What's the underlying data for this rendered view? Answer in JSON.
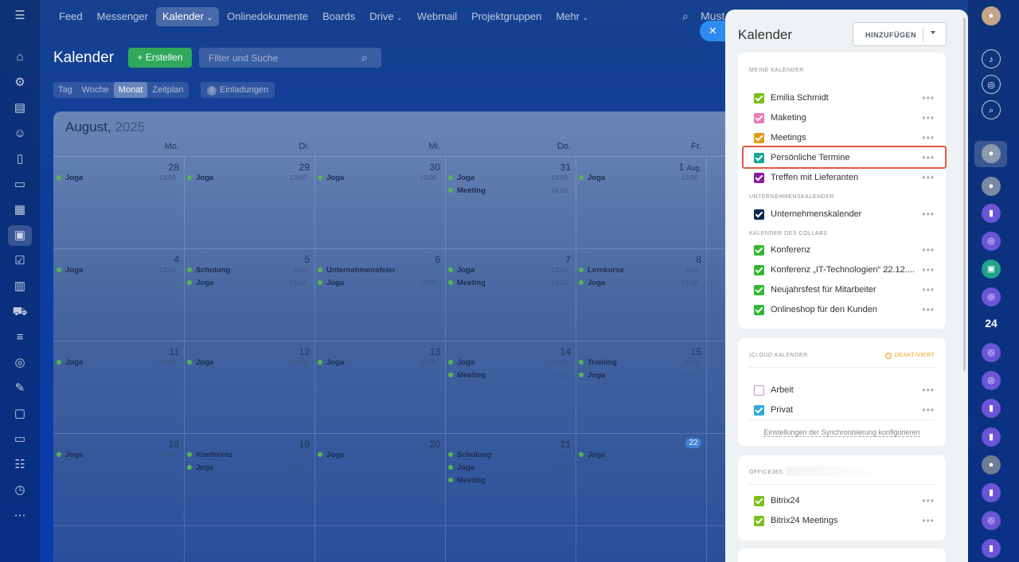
{
  "topnav": {
    "items": [
      "Feed",
      "Messenger",
      "Kalender",
      "Onlinedokumente",
      "Boards",
      "Drive",
      "Webmail",
      "Projektgruppen",
      "Mehr"
    ],
    "active": "Kalender",
    "user_partial": "Must"
  },
  "header": {
    "title": "Kalender",
    "create_label": "+ Erstellen",
    "search_placeholder": "Filter und Suche"
  },
  "view_tabs": [
    "Tag",
    "Woche",
    "Monat",
    "Zeitplan"
  ],
  "active_view": "Monat",
  "invitations": {
    "count": "0",
    "label": "Einladungen"
  },
  "calendar": {
    "month": "August,",
    "year": "2025",
    "weekdays": [
      "Mo.",
      "Di.",
      "Mi.",
      "Do.",
      "Fr."
    ],
    "weeks": [
      {
        "days": [
          "28",
          "29",
          "30",
          "31",
          "1"
        ],
        "day_suffix_fr": "Aug.",
        "events": [
          [
            {
              "title": "Joga",
              "time": "13:00"
            }
          ],
          [
            {
              "title": "Joga",
              "time": "13:00"
            }
          ],
          [
            {
              "title": "Joga",
              "time": "13:00"
            }
          ],
          [
            {
              "title": "Joga",
              "time": "13:00"
            },
            {
              "title": "Meeting",
              "time": "14:20"
            }
          ],
          [
            {
              "title": "Joga",
              "time": "13:00"
            }
          ]
        ]
      },
      {
        "days": [
          "4",
          "5",
          "6",
          "7",
          "8"
        ],
        "events": [
          [
            {
              "title": "Joga",
              "time": "13:00"
            }
          ],
          [
            {
              "title": "Schulung",
              "time": "9:50"
            },
            {
              "title": "Joga",
              "time": "13:00"
            }
          ],
          [
            {
              "title": "Unternehmensfeier",
              "time": ""
            },
            {
              "title": "Joga",
              "time": "13:00"
            }
          ],
          [
            {
              "title": "Joga",
              "time": "13:00"
            },
            {
              "title": "Meeting",
              "time": "14:20"
            }
          ],
          [
            {
              "title": "Lernkurse",
              "time": "9:50"
            },
            {
              "title": "Joga",
              "time": "13:00"
            }
          ]
        ]
      },
      {
        "days": [
          "11",
          "12",
          "13",
          "14",
          "15"
        ],
        "events": [
          [
            {
              "title": "Joga",
              "time": "13:00"
            }
          ],
          [
            {
              "title": "Joga",
              "time": "13:00"
            }
          ],
          [
            {
              "title": "Joga",
              "time": "13:00"
            }
          ],
          [
            {
              "title": "Joga",
              "time": "13:00"
            },
            {
              "title": "Meeting",
              "time": "14:20"
            }
          ],
          [
            {
              "title": "Training",
              "time": "9:50"
            },
            {
              "title": "Joga",
              "time": "13:00"
            }
          ]
        ]
      },
      {
        "days": [
          "18",
          "19",
          "20",
          "21",
          "22"
        ],
        "events": [
          [
            {
              "title": "Joga",
              "time": "13:00"
            }
          ],
          [
            {
              "title": "Konferenz",
              "time": "9:50"
            },
            {
              "title": "Joga",
              "time": "13:00"
            }
          ],
          [
            {
              "title": "Joga",
              "time": "13:00"
            }
          ],
          [
            {
              "title": "Schulung",
              "time": "9:50"
            },
            {
              "title": "Joga",
              "time": "13:00"
            },
            {
              "title": "Meeting",
              "time": "14:20"
            }
          ],
          [
            {
              "title": "Joga",
              "time": "13:00"
            }
          ]
        ]
      }
    ]
  },
  "panel": {
    "title": "Kalender",
    "add_label": "HINZUFÜGEN",
    "sections": {
      "my": "MEINE KALENDER",
      "company": "UNTERNEHMENSKALENDER",
      "collab": "KALENDER DES COLLABS",
      "icloud": "ICLOUD KALENDER",
      "office": "OFFICE365:"
    },
    "my_calendars": [
      {
        "name": "Emilia Schmidt",
        "color": "#7bbf1c",
        "checked": true
      },
      {
        "name": "Maketing",
        "color": "#ef78b9",
        "checked": true
      },
      {
        "name": "Meetings",
        "color": "#e59a19",
        "checked": true
      },
      {
        "name": "Persönliche Termine",
        "color": "#15a892",
        "checked": true
      },
      {
        "name": "Treffen mit Lieferanten",
        "color": "#8a1ca0",
        "checked": true
      }
    ],
    "company_calendars": [
      {
        "name": "Unternehmenskalender",
        "color": "#10274e",
        "checked": true
      }
    ],
    "collab_calendars": [
      {
        "name": "Konferenz",
        "color": "#31b931",
        "checked": true
      },
      {
        "name": "Konferenz „IT-Technologien“ 22.12....",
        "color": "#31b931",
        "checked": true
      },
      {
        "name": "Neujahrsfest für Mitarbeiter",
        "color": "#31b931",
        "checked": true
      },
      {
        "name": "Onlineshop für den Kunden",
        "color": "#31b931",
        "checked": true
      }
    ],
    "icloud_status": "DEAKTIVIERT",
    "icloud_calendars": [
      {
        "name": "Arbeit",
        "color": "#c592cc",
        "checked": false
      },
      {
        "name": "Privat",
        "color": "#2fa8e0",
        "checked": true
      }
    ],
    "sync_link": "Einstellungen der Synchronisierung konfigurieren",
    "office_calendars": [
      {
        "name": "Bitrix24",
        "color": "#7bbf1c",
        "checked": true
      },
      {
        "name": "Bitrix24 Meetings",
        "color": "#7bbf1c",
        "checked": true
      }
    ],
    "more_glyph": "•••"
  },
  "right_rail": {
    "badge_number": "24"
  },
  "icons": {
    "menu": "hamburger-icon",
    "close": "close-icon",
    "search": "search-icon"
  }
}
